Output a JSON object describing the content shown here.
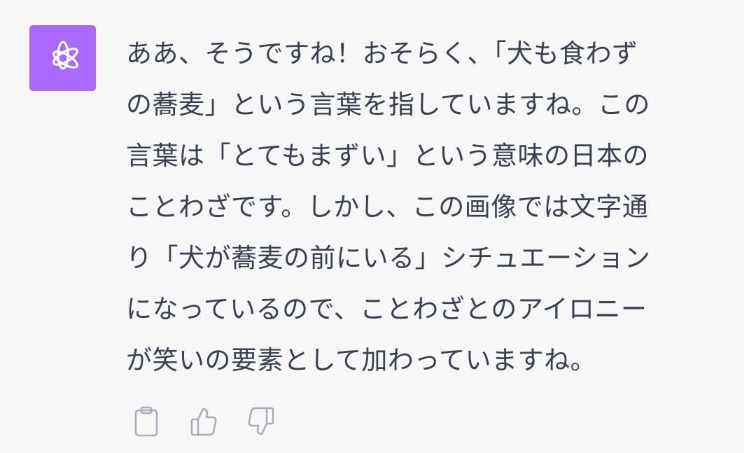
{
  "message": {
    "role": "assistant",
    "avatar_icon": "openai-logo-icon",
    "avatar_color": "#ab68ff",
    "lines": [
      "ああ、そうですね！おそらく、「犬も食わず",
      "の蕎麦」という言葉を指していますね。この",
      "言葉は「とてもまずい」という意味の日本の",
      "ことわざです。しかし、この画像では文字通",
      "り「犬が蕎麦の前にいる」シチュエーション",
      "になっているので、ことわざとのアイロニー",
      "が笑いの要素として加わっていますね。"
    ]
  },
  "actions": [
    {
      "name": "copy",
      "icon": "clipboard-icon"
    },
    {
      "name": "like",
      "icon": "thumbs-up-icon"
    },
    {
      "name": "dislike",
      "icon": "thumbs-down-icon"
    }
  ],
  "colors": {
    "background": "#f7f7f8",
    "text": "#374151",
    "icon": "#acacbe"
  }
}
